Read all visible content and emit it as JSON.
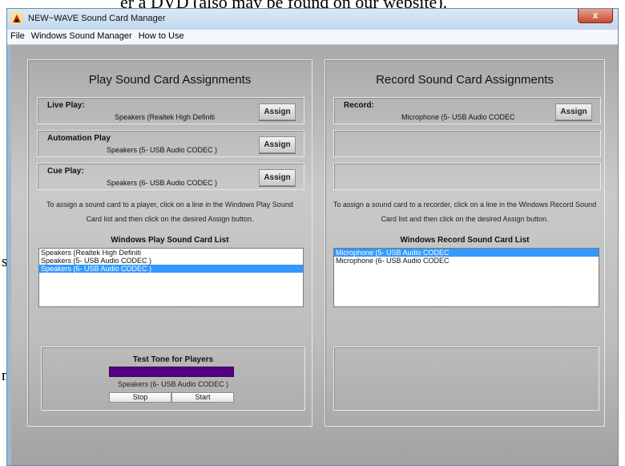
{
  "background": {
    "top_line": "er a DVD (also may be found on our website).",
    "letter_s": "s",
    "letter_n": "n"
  },
  "window": {
    "title": "NEW~WAVE Sound Card Manager",
    "close_label": "x"
  },
  "menu": [
    "File",
    "Windows Sound Manager",
    "How to Use"
  ],
  "play": {
    "title": "Play Sound Card Assignments",
    "live": {
      "label": "Live Play:",
      "device": "Speakers (Realtek High Definiti",
      "button": "Assign"
    },
    "automation": {
      "label": "Automation Play",
      "device": "Speakers (5- USB Audio CODEC )",
      "button": "Assign"
    },
    "cue": {
      "label": "Cue Play:",
      "device": "Speakers (6- USB Audio CODEC )",
      "button": "Assign"
    },
    "help_line1": "To assign a sound card to a player, click on a line in the Windows Play Sound",
    "help_line2": "Card list and then click on the desired Assign button.",
    "list_title": "Windows Play Sound Card List",
    "list": [
      "Speakers (Realtek High Definiti",
      "Speakers (5- USB Audio CODEC )",
      "Speakers (6- USB Audio CODEC )"
    ],
    "selected_index": 2
  },
  "test_tone": {
    "title": "Test Tone for Players",
    "device": "Speakers (6- USB Audio CODEC )",
    "stop": "Stop",
    "start": "Start",
    "bar_color": "#540083"
  },
  "record": {
    "title": "Record Sound Card Assignments",
    "rec": {
      "label": "Record:",
      "device": "Microphone (5- USB Audio CODEC",
      "button": "Assign"
    },
    "help_line1": "To assign a sound card to a recorder, click on a line in the Windows Record Sound",
    "help_line2": "Card list and then click on the desired Assign button.",
    "list_title": "Windows Record Sound Card List",
    "list": [
      "Microphone (5- USB Audio CODEC",
      "Microphone (6- USB Audio CODEC"
    ],
    "selected_index": 0
  },
  "colors": {
    "selection": "#3399ff",
    "window_frame": "#b0cde4",
    "close_button": "#c74a32"
  }
}
